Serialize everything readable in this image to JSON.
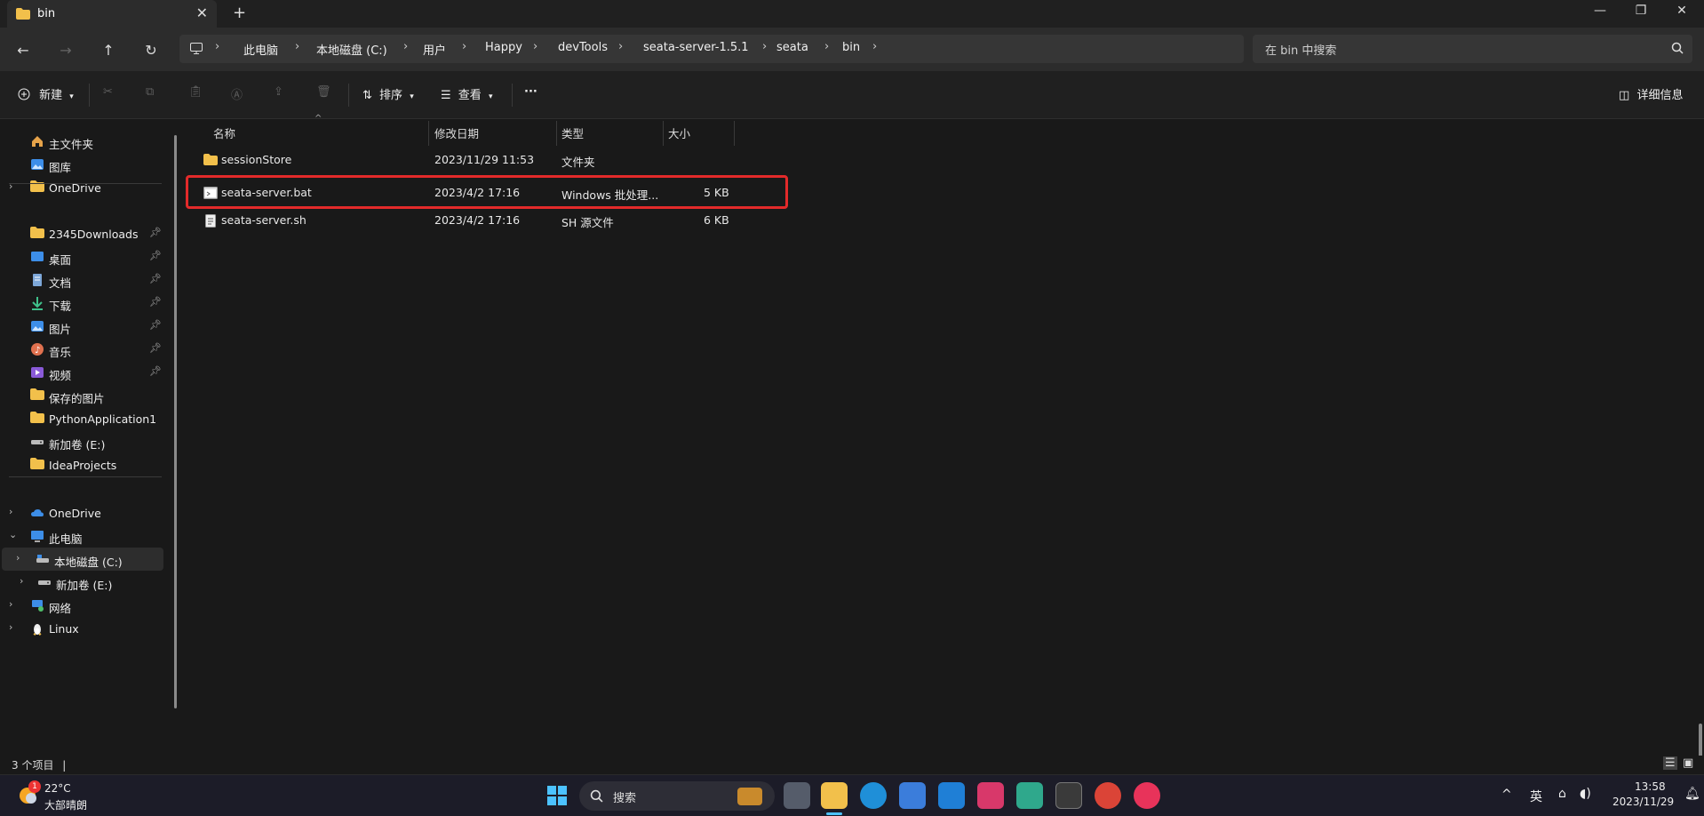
{
  "window": {
    "tab_title": "bin",
    "tab_close": "✕",
    "new_tab": "+",
    "minimize": "—",
    "maximize": "❐",
    "close": "✕"
  },
  "nav": {
    "back": "←",
    "forward": "→",
    "up": "↑",
    "refresh": "↻"
  },
  "breadcrumb": [
    "此电脑",
    "本地磁盘 (C:)",
    "用户",
    "Happy",
    "devTools",
    "seata-server-1.5.1",
    "seata",
    "bin"
  ],
  "breadcrumb_sep": "›",
  "search": {
    "placeholder": "在 bin 中搜索"
  },
  "toolbar": {
    "new_label": "新建",
    "sort_label": "排序",
    "view_label": "查看",
    "more_label": "···",
    "details_label": "详细信息"
  },
  "sidebar": {
    "top": [
      {
        "label": "主文件夹",
        "icon": "home-icon"
      },
      {
        "label": "图库",
        "icon": "gallery-icon"
      },
      {
        "label": "OneDrive",
        "icon": "folder-icon"
      }
    ],
    "quick": [
      {
        "label": "2345Downloads",
        "icon": "folder-icon"
      },
      {
        "label": "桌面",
        "icon": "desktop-icon"
      },
      {
        "label": "文档",
        "icon": "document-icon"
      },
      {
        "label": "下载",
        "icon": "download-icon"
      },
      {
        "label": "图片",
        "icon": "pictures-icon"
      },
      {
        "label": "音乐",
        "icon": "music-icon"
      },
      {
        "label": "视频",
        "icon": "video-icon"
      },
      {
        "label": "保存的图片",
        "icon": "folder-icon"
      },
      {
        "label": "PythonApplication1",
        "icon": "folder-icon"
      },
      {
        "label": "新加卷 (E:)",
        "icon": "drive-icon"
      },
      {
        "label": "IdeaProjects",
        "icon": "folder-icon"
      }
    ],
    "tree": [
      {
        "label": "OneDrive",
        "icon": "cloud-icon"
      },
      {
        "label": "此电脑",
        "icon": "pc-icon"
      },
      {
        "label": "本地磁盘 (C:)",
        "icon": "drive-c-icon"
      },
      {
        "label": "新加卷 (E:)",
        "icon": "drive-icon"
      },
      {
        "label": "网络",
        "icon": "network-icon"
      },
      {
        "label": "Linux",
        "icon": "linux-icon"
      }
    ]
  },
  "columns": {
    "name": "名称",
    "modified": "修改日期",
    "type": "类型",
    "size": "大小"
  },
  "files": [
    {
      "name": "sessionStore",
      "modified": "2023/11/29 11:53",
      "type": "文件夹",
      "size": "",
      "icon": "folder-icon"
    },
    {
      "name": "seata-server.bat",
      "modified": "2023/4/2 17:16",
      "type": "Windows 批处理...",
      "size": "5 KB",
      "icon": "batch-file-icon"
    },
    {
      "name": "seata-server.sh",
      "modified": "2023/4/2 17:16",
      "type": "SH 源文件",
      "size": "6 KB",
      "icon": "script-file-icon"
    }
  ],
  "status": {
    "count": "3 个项目",
    "divider": "|"
  },
  "taskbar": {
    "weather_temp": "22°C",
    "weather_desc": "大部晴朗",
    "weather_badge": "1",
    "search_label": "搜索",
    "ime": "英",
    "time": "13:58",
    "date": "2023/11/29"
  },
  "colors": {
    "accent": "#e32a2a",
    "folder": "#f2c04b"
  }
}
